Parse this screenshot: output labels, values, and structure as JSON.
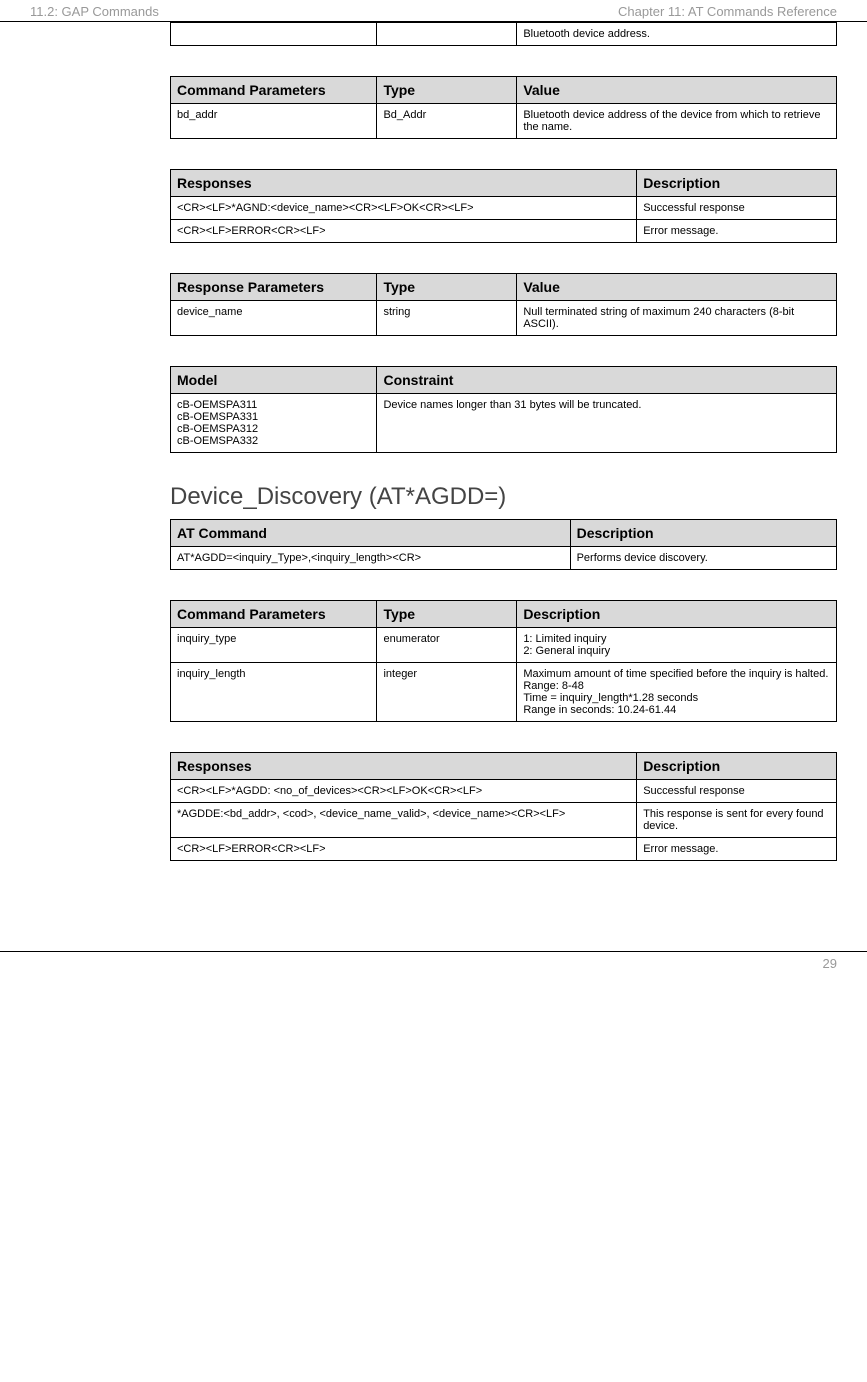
{
  "header": {
    "left": "11.2: GAP Commands",
    "right": "Chapter 11: AT Commands Reference"
  },
  "table_frag": {
    "cell": "Bluetooth device address."
  },
  "table_cmdparams1": {
    "h1": "Command Parameters",
    "h2": "Type",
    "h3": "Value",
    "r1c1": "bd_addr",
    "r1c2": "Bd_Addr",
    "r1c3": "Bluetooth device address of the device from which to retrieve the name."
  },
  "table_resp1": {
    "h1": "Responses",
    "h2": "Description",
    "r1c1": "<CR><LF>*AGND:<device_name><CR><LF>OK<CR><LF>",
    "r1c2": "Successful response",
    "r2c1": "<CR><LF>ERROR<CR><LF>",
    "r2c2": "Error message."
  },
  "table_respparams1": {
    "h1": "Response Parameters",
    "h2": "Type",
    "h3": "Value",
    "r1c1": "device_name",
    "r1c2": "string",
    "r1c3": "Null terminated string of maximum 240 characters (8-bit ASCII)."
  },
  "table_model": {
    "h1": "Model",
    "h2": "Constraint",
    "r1c1": "cB-OEMSPA311\ncB-OEMSPA331\ncB-OEMSPA312\ncB-OEMSPA332",
    "r1c2": "Device names longer than 31 bytes will be truncated."
  },
  "section_title": "Device_Discovery (AT*AGDD=)",
  "table_atcmd": {
    "h1": "AT Command",
    "h2": "Description",
    "r1c1": "AT*AGDD=<inquiry_Type>,<inquiry_length><CR>",
    "r1c2": "Performs device discovery."
  },
  "table_cmdparams2": {
    "h1": "Command Parameters",
    "h2": "Type",
    "h3": "Description",
    "r1c1": "inquiry_type",
    "r1c2": "enumerator",
    "r1c3": "1: Limited inquiry\n2: General inquiry",
    "r2c1": "inquiry_length",
    "r2c2": "integer",
    "r2c3": "Maximum amount of time specified before the inquiry is halted.\nRange: 8-48\nTime = inquiry_length*1.28 seconds\nRange in seconds: 10.24-61.44"
  },
  "table_resp2": {
    "h1": "Responses",
    "h2": "Description",
    "r1c1": "<CR><LF>*AGDD: <no_of_devices><CR><LF>OK<CR><LF>",
    "r1c2": "Successful response",
    "r2c1": "*AGDDE:<bd_addr>, <cod>, <device_name_valid>, <device_name><CR><LF>",
    "r2c2": "This response is sent for every found device.",
    "r3c1": "<CR><LF>ERROR<CR><LF>",
    "r3c2": "Error message."
  },
  "footer": {
    "page": "29"
  }
}
